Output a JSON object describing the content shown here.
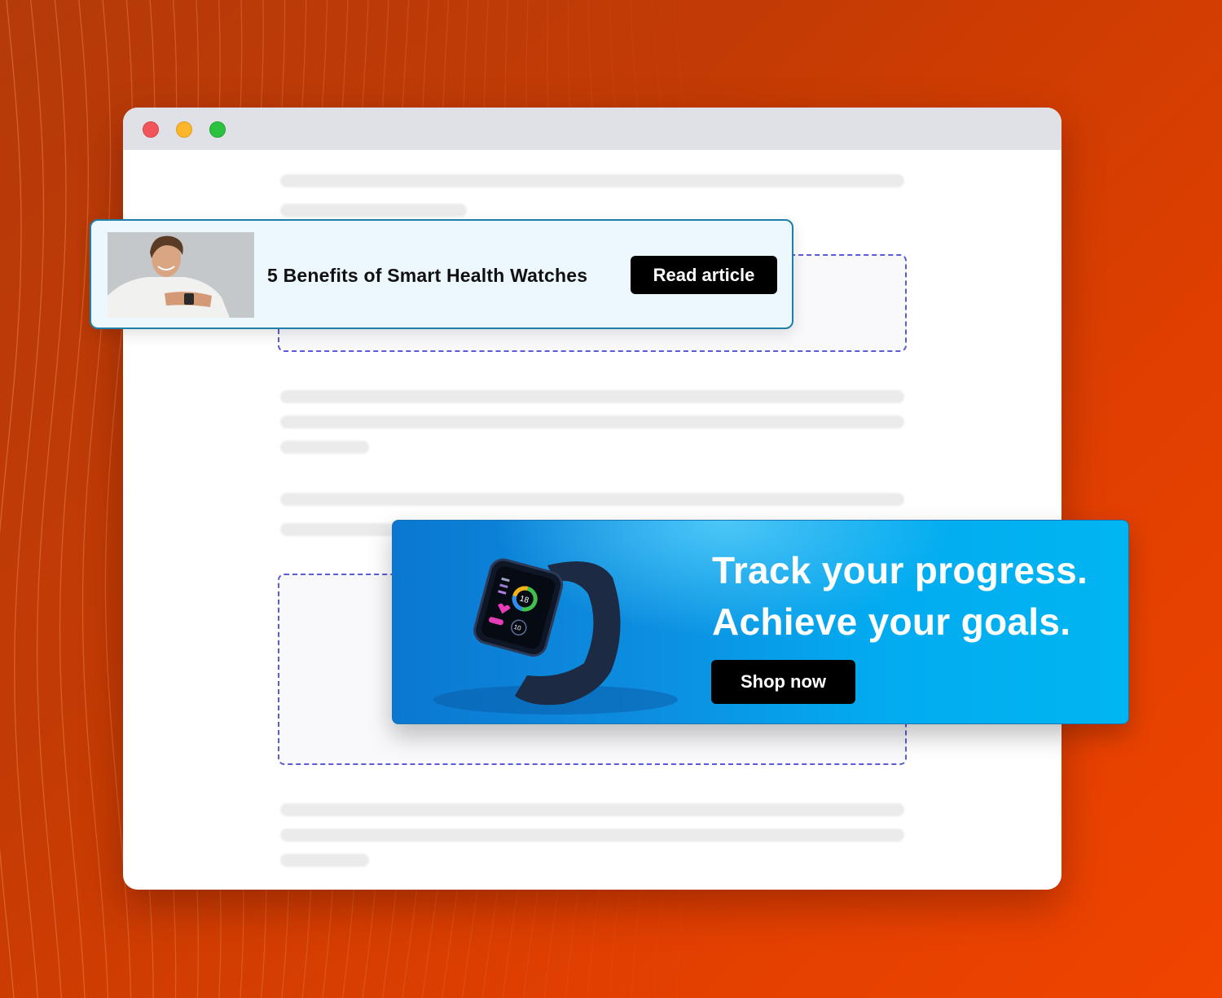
{
  "window": {
    "controls": [
      "close",
      "minimize",
      "maximize"
    ]
  },
  "article_card": {
    "thumbnail": "man-checking-smartwatch-photo",
    "title": "5 Benefits of Smart Health Watches",
    "button_label": "Read article"
  },
  "banner": {
    "image": "smartwatch-on-blue-photo",
    "watch_face": {
      "center_value": "18",
      "sub_value": "10"
    },
    "headline_line1": "Track your progress.",
    "headline_line2": "Achieve your goals.",
    "button_label": "Shop now"
  },
  "colors": {
    "background": "#d23d02",
    "slot_border": "#5b5bd6",
    "card_border": "#1e7fa8",
    "banner_blue": "#03aaef",
    "button": "#000000"
  }
}
